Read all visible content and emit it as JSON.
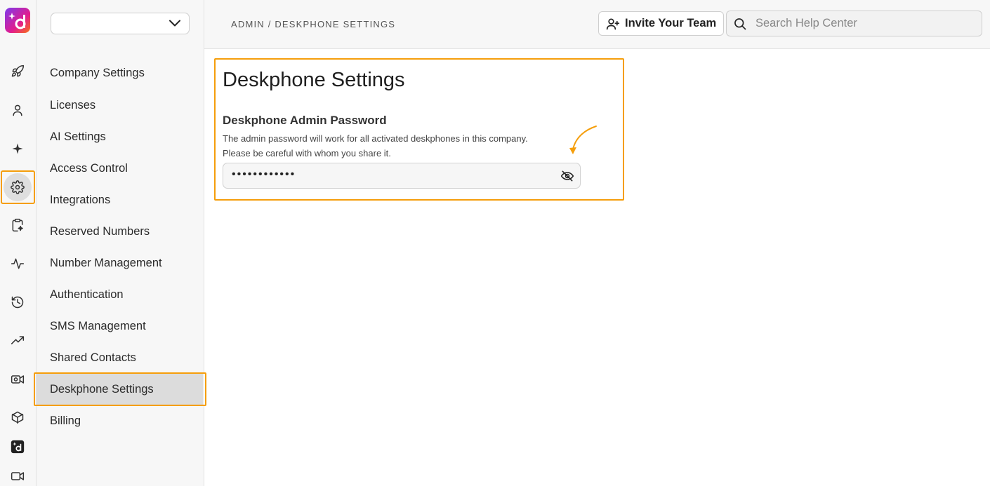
{
  "rail": {
    "icons": [
      "rocket-icon",
      "person-icon",
      "sparkle-icon",
      "gear-icon",
      "clipboard-sparkle-icon",
      "pulse-icon",
      "history-icon",
      "trend-icon",
      "video-gear-icon",
      "cube-icon",
      "dialpad-app-icon",
      "video-icon"
    ],
    "active": "gear-icon"
  },
  "sidebar": {
    "select_value": "",
    "items": [
      {
        "label": "Company Settings"
      },
      {
        "label": "Licenses"
      },
      {
        "label": "AI Settings"
      },
      {
        "label": "Access Control"
      },
      {
        "label": "Integrations"
      },
      {
        "label": "Reserved Numbers"
      },
      {
        "label": "Number Management"
      },
      {
        "label": "Authentication"
      },
      {
        "label": "SMS Management"
      },
      {
        "label": "Shared Contacts"
      },
      {
        "label": "Deskphone Settings"
      },
      {
        "label": "Billing"
      }
    ],
    "active_item": "Deskphone Settings"
  },
  "header": {
    "breadcrumb": "ADMIN / DESKPHONE SETTINGS",
    "invite_label": "Invite Your Team",
    "search_placeholder": "Search Help Center"
  },
  "main": {
    "title": "Deskphone Settings",
    "password_label": "Deskphone Admin Password",
    "help_line1": "The admin password will work for all activated deskphones in this company.",
    "help_line2": "Please be careful with whom you share it.",
    "password_value": "••••••••••••"
  },
  "colors": {
    "highlight": "#f59e0b",
    "active_nav_bg": "#dcdcdc"
  }
}
